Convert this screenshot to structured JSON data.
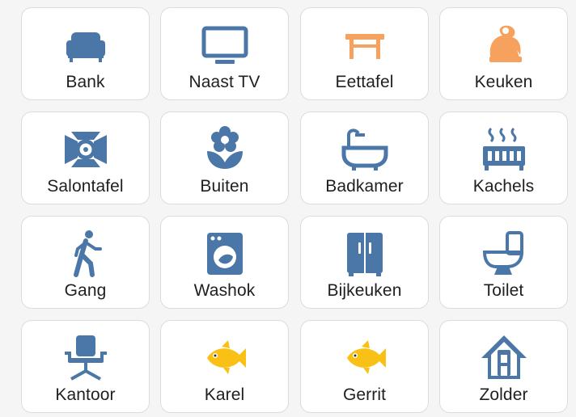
{
  "colors": {
    "blue": "#4a77a8",
    "orange": "#f6a25e",
    "yellow": "#f9c016",
    "tile_bg": "#ffffff",
    "tile_border": "#dcdcdc",
    "label": "#1f1f1f"
  },
  "tiles": [
    {
      "label": "Bank",
      "icon": "sofa-icon",
      "color": "blue"
    },
    {
      "label": "Naast TV",
      "icon": "television-icon",
      "color": "blue"
    },
    {
      "label": "Eettafel",
      "icon": "table-icon",
      "color": "orange"
    },
    {
      "label": "Keuken",
      "icon": "kettle-icon",
      "color": "orange"
    },
    {
      "label": "Salontafel",
      "icon": "spotlight-icon",
      "color": "blue"
    },
    {
      "label": "Buiten",
      "icon": "flower-icon",
      "color": "blue"
    },
    {
      "label": "Badkamer",
      "icon": "bathtub-icon",
      "color": "blue"
    },
    {
      "label": "Kachels",
      "icon": "radiator-icon",
      "color": "blue"
    },
    {
      "label": "Gang",
      "icon": "walking-person-icon",
      "color": "blue"
    },
    {
      "label": "Washok",
      "icon": "washing-machine-icon",
      "color": "blue"
    },
    {
      "label": "Bijkeuken",
      "icon": "fridge-icon",
      "color": "blue"
    },
    {
      "label": "Toilet",
      "icon": "toilet-icon",
      "color": "blue"
    },
    {
      "label": "Kantoor",
      "icon": "office-chair-icon",
      "color": "blue"
    },
    {
      "label": "Karel",
      "icon": "fish-icon",
      "color": "yellow"
    },
    {
      "label": "Gerrit",
      "icon": "fish-icon",
      "color": "yellow"
    },
    {
      "label": "Zolder",
      "icon": "house-attic-icon",
      "color": "blue"
    }
  ]
}
